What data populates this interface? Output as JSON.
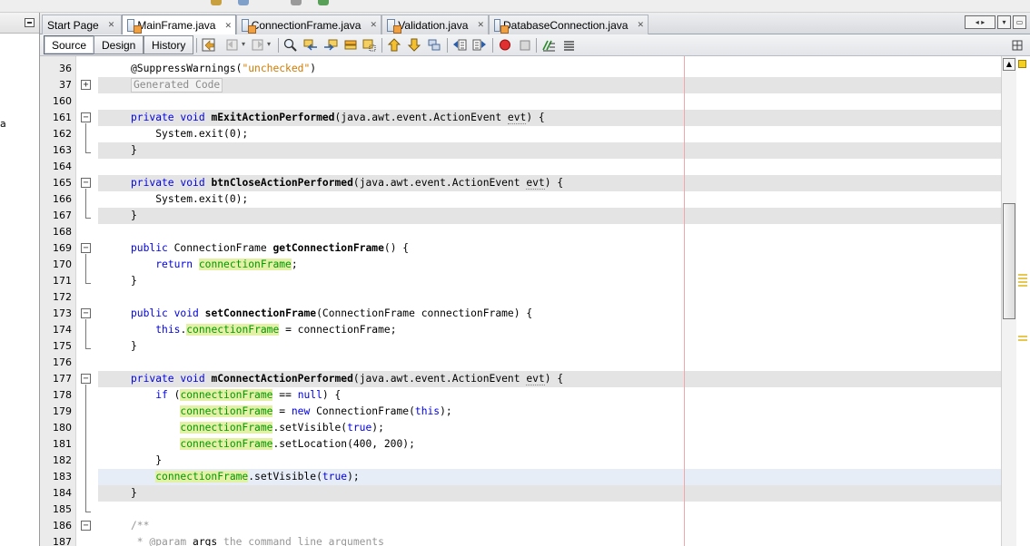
{
  "left_panel": {
    "fragment_text": "a"
  },
  "tabs": [
    {
      "label": "Start Page",
      "active": false,
      "has_icon": false
    },
    {
      "label": "MainFrame.java",
      "active": true,
      "has_icon": true
    },
    {
      "label": "ConnectionFrame.java",
      "active": false,
      "has_icon": true
    },
    {
      "label": "Validation.java",
      "active": false,
      "has_icon": true
    },
    {
      "label": "DatabaseConnection.java",
      "active": false,
      "has_icon": true
    }
  ],
  "tab_close_glyph": "✕",
  "view_buttons": {
    "source": "Source",
    "design": "Design",
    "history": "History"
  },
  "gutter_lines": [
    "36",
    "37",
    "160",
    "161",
    "162",
    "163",
    "164",
    "165",
    "166",
    "167",
    "168",
    "169",
    "170",
    "171",
    "172",
    "173",
    "174",
    "175",
    "176",
    "177",
    "178",
    "179",
    "180",
    "181",
    "182",
    "183",
    "184",
    "185",
    "186",
    "187"
  ],
  "code": {
    "l36_annotation": "@SuppressWarnings(",
    "l36_string": "\"unchecked\"",
    "l36_close": ")",
    "l37_folded": "Generated Code",
    "kw_private": "private",
    "kw_public": "public",
    "kw_void": "void",
    "kw_return": "return",
    "kw_this": "this",
    "kw_if": "if",
    "kw_null": "null",
    "kw_new": "new",
    "kw_true": "true",
    "m_exit": "mExitActionPerformed",
    "m_close": "btnCloseActionPerformed",
    "m_getcf": "getConnectionFrame",
    "m_setcf": "setConnectionFrame",
    "m_connect": "mConnectActionPerformed",
    "param_open": "(java.awt.event.ActionEvent ",
    "param_evt": "evt",
    "param_close": ") {",
    "sys_exit": "System.exit(0);",
    "close_brace": "}",
    "type_cf": "ConnectionFrame",
    "getcf_tail": "() {",
    "field": "connectionFrame",
    "semi": ";",
    "setcf_param": "(ConnectionFrame connectionFrame) {",
    "dot": ".",
    "assign_param": " = connectionFrame;",
    "if_open": " (",
    "eq_null": " == ",
    "if_close": ") {",
    "assign_new": " = ",
    "new_cf": " ConnectionFrame(",
    "paren_semi": ");",
    "set_visible": ".setVisible(",
    "set_location": ".setLocation(400, 200);",
    "javadoc_open": "/**",
    "javadoc_param": " * @param ",
    "javadoc_args": "args",
    "javadoc_desc": " the command line arguments"
  },
  "colors": {
    "keyword": "#0000e6",
    "string": "#ce7b00",
    "field": "#009900",
    "field_bg": "#e3f0a6",
    "comment": "#969696",
    "fold_highlight": "#e4e4e4",
    "current_line": "#e6edf7",
    "margin_line": "#f0a8a8"
  },
  "icons": [
    "minimize-icon",
    "java-file-icon",
    "scroll-left-icon",
    "scroll-right-icon",
    "tab-list-icon",
    "maximize-icon",
    "last-edit-icon",
    "back-icon",
    "forward-icon",
    "find-icon",
    "find-previous-icon",
    "find-next-icon",
    "toggle-highlight-icon",
    "toggle-rect-selection-icon",
    "previous-bookmark-icon",
    "next-bookmark-icon",
    "toggle-bookmark-icon",
    "shift-left-icon",
    "shift-right-icon",
    "start-macro-icon",
    "stop-macro-icon",
    "comment-icon",
    "uncomment-icon",
    "split-icon",
    "scroll-up-icon"
  ]
}
